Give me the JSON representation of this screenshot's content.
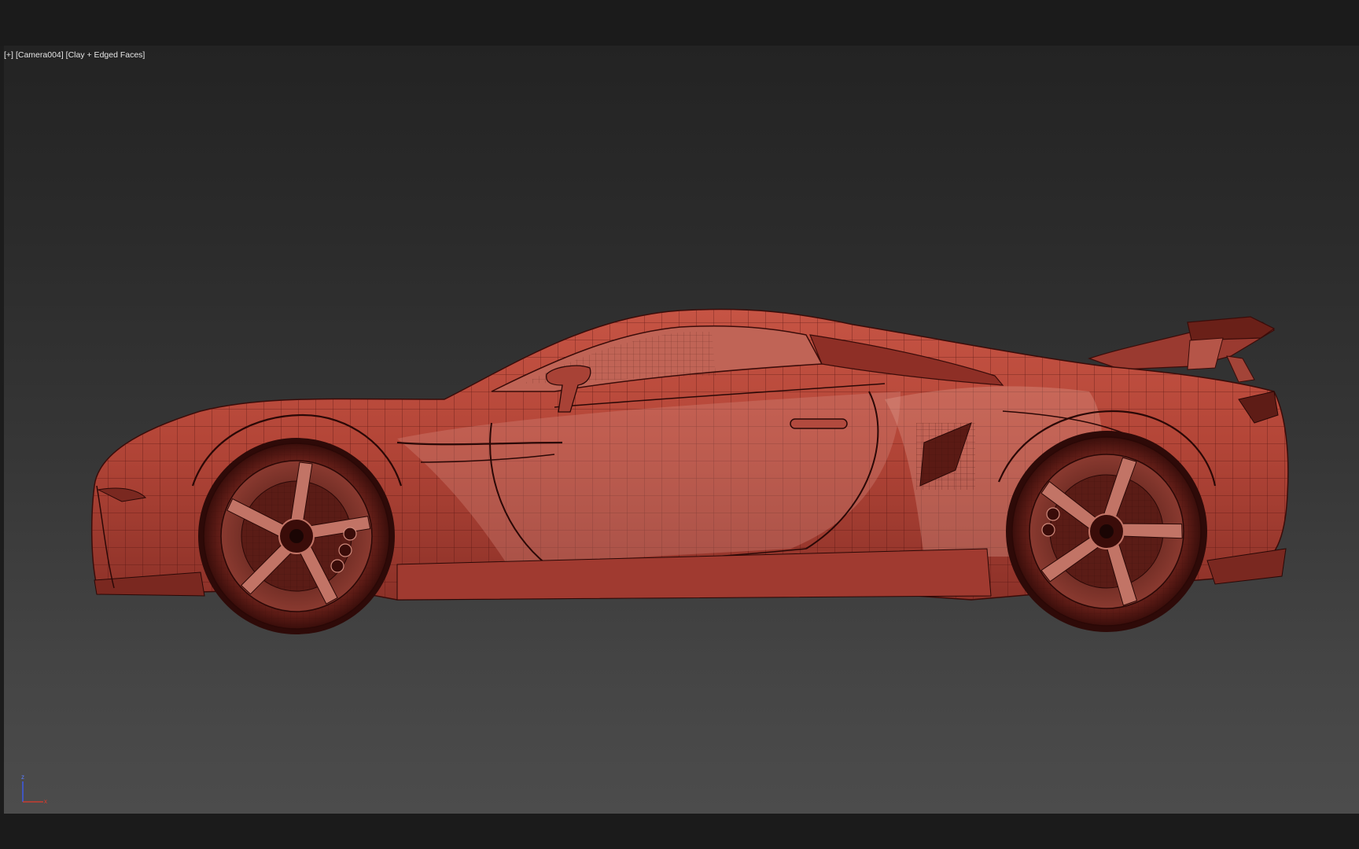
{
  "viewport": {
    "menu_label": "[+]",
    "camera_label": "[Camera004]",
    "shading_label": "[Clay + Edged Faces]"
  },
  "axis_gizmo": {
    "z_label": "z",
    "x_label": "x"
  },
  "colors": {
    "clay": "#b8483c",
    "wire": "#4a0f0c",
    "background_top": "#232323",
    "background_bottom": "#4c4c4c"
  }
}
